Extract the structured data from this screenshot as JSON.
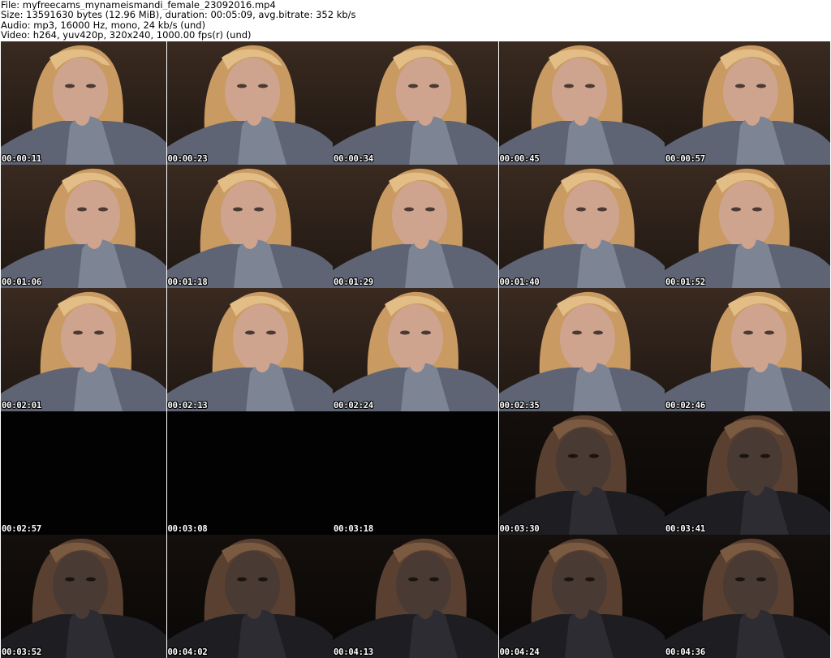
{
  "header": {
    "file_line": "File: myfreecams_mynameismandi_female_23092016.mp4",
    "size_line": "Size: 13591630 bytes (12.96 MiB), duration: 00:05:09, avg.bitrate: 352 kb/s",
    "audio_line": "Audio: mp3, 16000 Hz, mono, 24 kb/s (und)",
    "video_line": "Video: h264, yuv420p, 320x240, 1000.00 fps(r) (und)"
  },
  "thumbnails": [
    {
      "timestamp": "00:00:11",
      "tone": "bright"
    },
    {
      "timestamp": "00:00:23",
      "tone": "bright"
    },
    {
      "timestamp": "00:00:34",
      "tone": "bright"
    },
    {
      "timestamp": "00:00:45",
      "tone": "bright"
    },
    {
      "timestamp": "00:00:57",
      "tone": "bright"
    },
    {
      "timestamp": "00:01:06",
      "tone": "bright"
    },
    {
      "timestamp": "00:01:18",
      "tone": "bright"
    },
    {
      "timestamp": "00:01:29",
      "tone": "bright"
    },
    {
      "timestamp": "00:01:40",
      "tone": "bright"
    },
    {
      "timestamp": "00:01:52",
      "tone": "bright"
    },
    {
      "timestamp": "00:02:01",
      "tone": "bright"
    },
    {
      "timestamp": "00:02:13",
      "tone": "bright"
    },
    {
      "timestamp": "00:02:24",
      "tone": "bright"
    },
    {
      "timestamp": "00:02:35",
      "tone": "bright"
    },
    {
      "timestamp": "00:02:46",
      "tone": "bright"
    },
    {
      "timestamp": "00:02:57",
      "tone": "black"
    },
    {
      "timestamp": "00:03:08",
      "tone": "black"
    },
    {
      "timestamp": "00:03:18",
      "tone": "black"
    },
    {
      "timestamp": "00:03:30",
      "tone": "dark"
    },
    {
      "timestamp": "00:03:41",
      "tone": "dark"
    },
    {
      "timestamp": "00:03:52",
      "tone": "dark"
    },
    {
      "timestamp": "00:04:02",
      "tone": "dark"
    },
    {
      "timestamp": "00:04:13",
      "tone": "dark"
    },
    {
      "timestamp": "00:04:24",
      "tone": "dark"
    },
    {
      "timestamp": "00:04:36",
      "tone": "dark"
    }
  ],
  "colors": {
    "background": "#ffffff",
    "header_text": "#000000",
    "timestamp_text": "#ffffff"
  }
}
